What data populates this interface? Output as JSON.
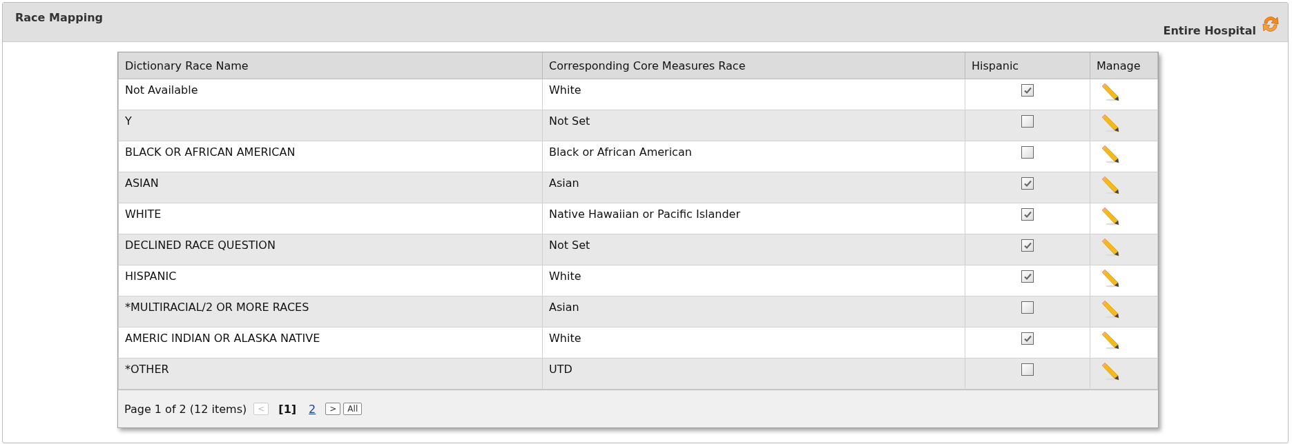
{
  "panel": {
    "title": "Race Mapping",
    "scope": "Entire Hospital"
  },
  "table": {
    "columns": [
      "Dictionary Race Name",
      "Corresponding Core Measures Race",
      "Hispanic",
      "Manage"
    ],
    "rows": [
      {
        "name": "Not Available",
        "core_race": "White",
        "hispanic": true
      },
      {
        "name": "Y",
        "core_race": "Not Set",
        "hispanic": false
      },
      {
        "name": "BLACK OR AFRICAN AMERICAN",
        "core_race": "Black or African American",
        "hispanic": false
      },
      {
        "name": "ASIAN",
        "core_race": "Asian",
        "hispanic": true
      },
      {
        "name": "WHITE",
        "core_race": "Native Hawaiian or Pacific Islander",
        "hispanic": true
      },
      {
        "name": "DECLINED RACE QUESTION",
        "core_race": "Not Set",
        "hispanic": true
      },
      {
        "name": "HISPANIC",
        "core_race": "White",
        "hispanic": true
      },
      {
        "name": "*MULTIRACIAL/2 OR MORE RACES",
        "core_race": "Asian",
        "hispanic": false
      },
      {
        "name": "AMERIC INDIAN OR ALASKA NATIVE",
        "core_race": "White",
        "hispanic": true
      },
      {
        "name": "*OTHER",
        "core_race": "UTD",
        "hispanic": false
      }
    ]
  },
  "pager": {
    "summary": "Page 1 of 2 (12 items)",
    "prev": {
      "label": "<",
      "disabled": true
    },
    "pages": [
      {
        "label": "[1]",
        "selected": true
      },
      {
        "label": "2",
        "selected": false
      }
    ],
    "next": {
      "label": ">",
      "disabled": false
    },
    "all": {
      "label": "All"
    }
  }
}
